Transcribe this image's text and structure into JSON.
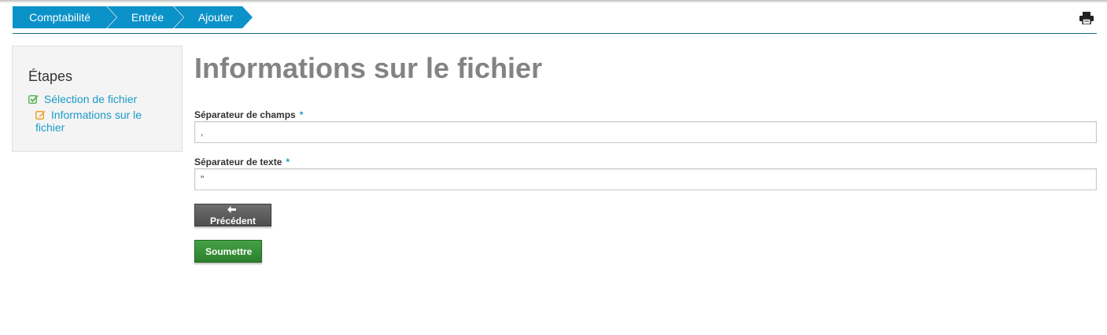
{
  "breadcrumb": {
    "items": [
      "Comptabilité",
      "Entrée",
      "Ajouter"
    ],
    "color": "#0b92c9"
  },
  "toolbar": {
    "print_icon": "print-icon"
  },
  "sidebar": {
    "title": "Étapes",
    "steps": [
      {
        "label": "Sélection de fichier",
        "icon": "check-square-icon",
        "icon_color": "#5cb85c",
        "status": "done"
      },
      {
        "label": "Informations sur le fichier",
        "icon": "edit-icon",
        "icon_color": "#f0a030",
        "status": "current"
      }
    ]
  },
  "main": {
    "title": "Informations sur le fichier",
    "fields": [
      {
        "label": "Séparateur de champs",
        "required_mark": "*",
        "value": ","
      },
      {
        "label": "Séparateur de texte",
        "required_mark": "*",
        "value": "\""
      }
    ],
    "buttons": {
      "previous": {
        "label": "Précédent",
        "icon": "arrow-left-icon",
        "color": "#5e5e5e"
      },
      "submit": {
        "label": "Soumettre",
        "color": "#379137"
      }
    }
  }
}
